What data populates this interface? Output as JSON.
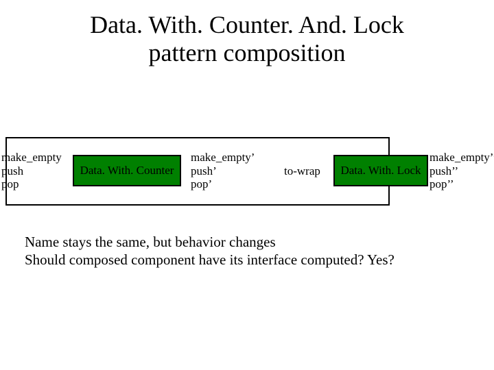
{
  "title_line1": "Data. With. Counter. And. Lock",
  "title_line2": "pattern composition",
  "inputs": {
    "line1": "make_empty",
    "line2": "push",
    "line3": "pop"
  },
  "box1": {
    "label": "Data. With. Counter",
    "bg": "#008000"
  },
  "mid": {
    "line1": "make_empty’",
    "line2": "push’",
    "line3": "pop’"
  },
  "towrap": "to-wrap",
  "box2": {
    "label": "Data. With. Lock",
    "bg": "#008000"
  },
  "outputs": {
    "line1": "make_empty’’",
    "line2": "push’’",
    "line3": "pop’’"
  },
  "notes": {
    "line1": "Name stays the same, but behavior changes",
    "line2": "Should composed component have its interface computed? Yes?"
  }
}
